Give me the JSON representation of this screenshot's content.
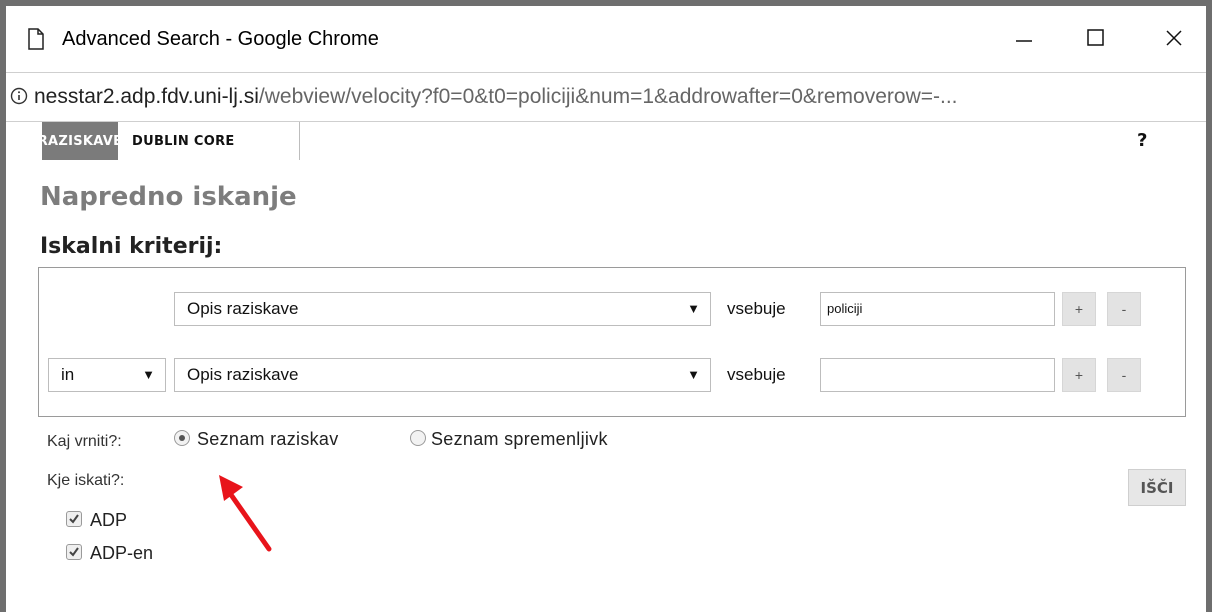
{
  "window": {
    "title": "Advanced Search - Google Chrome",
    "url_host": "nesstar2.adp.fdv.uni-lj.si",
    "url_path": "/webview/velocity?f0=0&t0=policiji&num=1&addrowafter=0&removerow=-..."
  },
  "tabs": [
    {
      "label": "RAZISKAVE",
      "active": true
    },
    {
      "label": "DUBLIN CORE",
      "active": false
    }
  ],
  "help_label": "?",
  "page_title": "Napredno iskanje",
  "criteria_heading": "Iskalni kriterij:",
  "rows": [
    {
      "field": "Opis raziskave",
      "operator_label": "vsebuje",
      "value": "policiji"
    },
    {
      "logic": "in",
      "field": "Opis raziskave",
      "operator_label": "vsebuje",
      "value": ""
    }
  ],
  "add_label": "+",
  "remove_label": "-",
  "return_label": "Kaj vrniti?:",
  "return_options": [
    {
      "label": "Seznam raziskav",
      "selected": true
    },
    {
      "label": "Seznam spremenljivk",
      "selected": false
    }
  ],
  "where_label": "Kje iskati?:",
  "sources": [
    {
      "label": "ADP",
      "checked": true
    },
    {
      "label": "ADP-en",
      "checked": true
    }
  ],
  "search_button": "IŠČI",
  "colors": {
    "annotation_arrow": "#e8141b",
    "tab_active_bg": "#7b7b7b"
  }
}
